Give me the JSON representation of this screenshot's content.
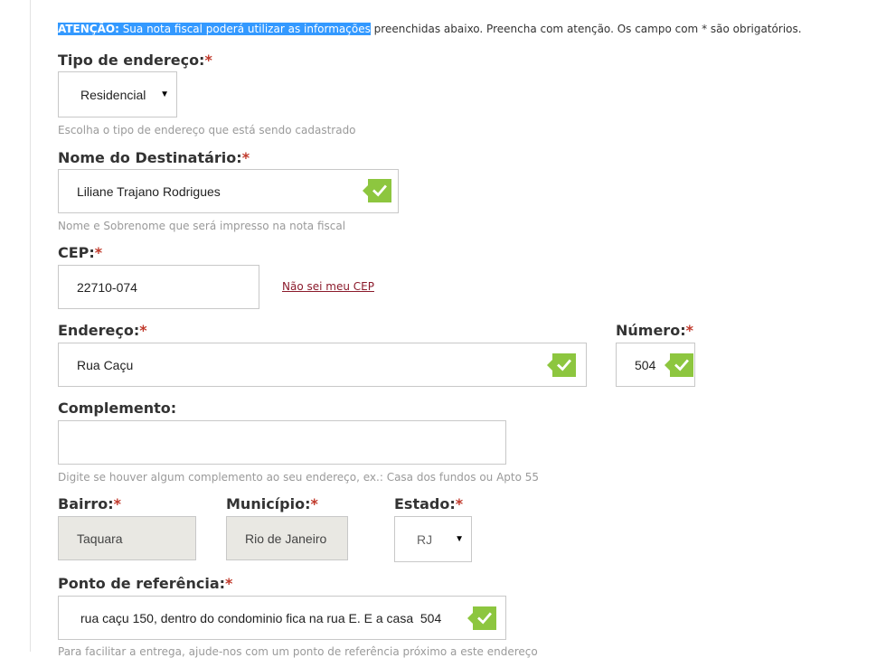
{
  "notice": {
    "highlight_prefix": "ATENÇÃO:",
    "highlight_text": " Sua nota fiscal poderá utilizar as informações",
    "rest_text": " preenchidas abaixo. Preencha com atenção. Os campo com * são obrigatórios."
  },
  "required_mark": "*",
  "address_type": {
    "label": "Tipo de endereço:",
    "selected": "Residencial",
    "hint": "Escolha o tipo de endereço que está sendo cadastrado"
  },
  "recipient": {
    "label": "Nome do Destinatário:",
    "value": "Liliane Trajano Rodrigues",
    "hint": "Nome e Sobrenome que será impresso na nota fiscal"
  },
  "cep": {
    "label": "CEP:",
    "value": "22710-074",
    "link": "Não sei meu CEP"
  },
  "address": {
    "label": "Endereço:",
    "value": "Rua Caçu"
  },
  "number": {
    "label": "Número:",
    "value": "504"
  },
  "complement": {
    "label": "Complemento:",
    "value": "",
    "hint": "Digite se houver algum complemento ao seu endereço, ex.: Casa dos fundos ou Apto 55"
  },
  "neighborhood": {
    "label": "Bairro:",
    "value": "Taquara"
  },
  "city": {
    "label": "Município:",
    "value": "Rio de Janeiro"
  },
  "state": {
    "label": "Estado:",
    "selected": "RJ"
  },
  "reference": {
    "label": "Ponto de referência:",
    "value": "rua caçu 150, dentro do condominio fica na rua E. E a casa  504",
    "hint": "Para facilitar a entrega, ajude-nos com um ponto de referência próximo a este endereço"
  },
  "colors": {
    "valid_check": "#8dc63f",
    "required_star": "#c0392b",
    "selection_highlight": "#3399ff",
    "link": "#8b1a2b"
  },
  "icons": {
    "valid": "check-icon",
    "dropdown": "caret-down-icon"
  }
}
